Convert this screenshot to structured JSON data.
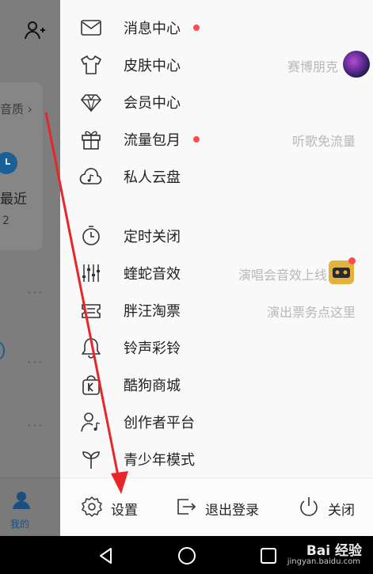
{
  "background_app": {
    "quality_label": "音质 ›",
    "recent_label": "最近",
    "recent_count": "2",
    "dots": "···",
    "tab_my_label": "我的"
  },
  "drawer": {
    "menu": [
      {
        "label": "消息中心",
        "icon": "mail-icon",
        "badge": true
      },
      {
        "label": "皮肤中心",
        "icon": "tshirt-icon",
        "subtitle": "赛博朋克"
      },
      {
        "label": "会员中心",
        "icon": "diamond-icon"
      },
      {
        "label": "流量包月",
        "icon": "gift-icon",
        "badge": true,
        "subtitle": "听歌免流量"
      },
      {
        "label": "私人云盘",
        "icon": "cloud-music-icon"
      },
      {
        "label": "定时关闭",
        "icon": "timer-icon"
      },
      {
        "label": "蝰蛇音效",
        "icon": "equalizer-icon",
        "subtitle": "演唱会音效上线"
      },
      {
        "label": "胖汪淘票",
        "icon": "ticket-icon",
        "subtitle": "演出票务点这里"
      },
      {
        "label": "铃声彩铃",
        "icon": "bell-icon"
      },
      {
        "label": "酷狗商城",
        "icon": "shopping-bag-icon"
      },
      {
        "label": "创作者平台",
        "icon": "creator-icon"
      },
      {
        "label": "青少年模式",
        "icon": "sprout-icon"
      }
    ],
    "footer": {
      "settings_label": "设置",
      "logout_label": "退出登录",
      "close_label": "关闭"
    }
  },
  "watermark": {
    "text": "Bai 经验",
    "sub": "jingyan.baidu.com"
  },
  "colors": {
    "badge_red": "#ff4b4b",
    "annotation_red": "#e8262a",
    "accent_blue": "#1a5f95"
  }
}
